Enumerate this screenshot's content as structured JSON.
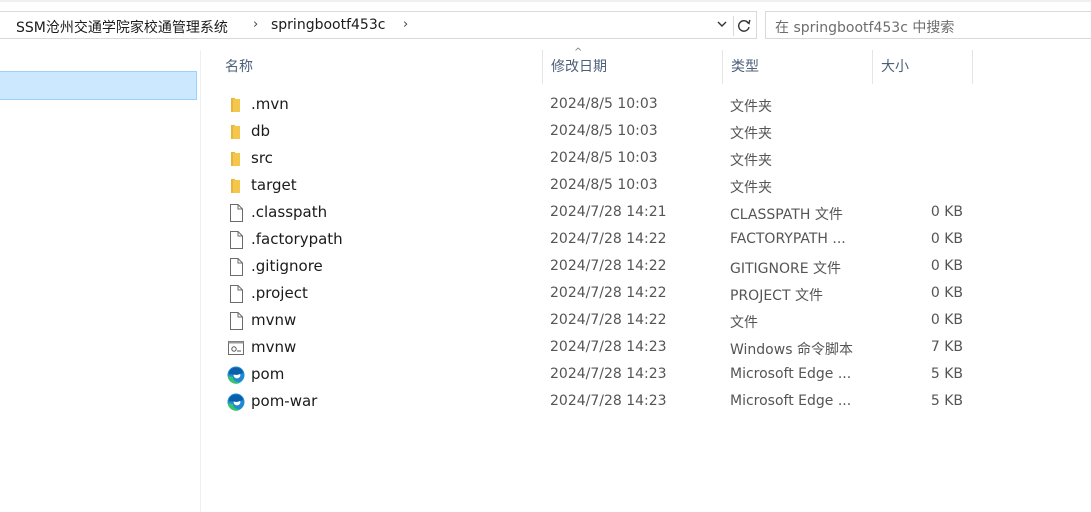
{
  "address_bar": {
    "crumbs": [
      "SSM沧州交通学院家校通管理系统",
      "springbootf453c"
    ]
  },
  "search": {
    "placeholder": "在 springbootf453c 中搜索"
  },
  "columns": {
    "name": "名称",
    "date": "修改日期",
    "type": "类型",
    "size": "大小"
  },
  "files": [
    {
      "name": ".mvn",
      "date": "2024/8/5 10:03",
      "type": "文件夹",
      "size": "",
      "icon": "folder-icon"
    },
    {
      "name": "db",
      "date": "2024/8/5 10:03",
      "type": "文件夹",
      "size": "",
      "icon": "folder-icon"
    },
    {
      "name": "src",
      "date": "2024/8/5 10:03",
      "type": "文件夹",
      "size": "",
      "icon": "folder-icon"
    },
    {
      "name": "target",
      "date": "2024/8/5 10:03",
      "type": "文件夹",
      "size": "",
      "icon": "folder-icon"
    },
    {
      "name": ".classpath",
      "date": "2024/7/28 14:21",
      "type": "CLASSPATH 文件",
      "size": "0 KB",
      "icon": "file-icon"
    },
    {
      "name": ".factorypath",
      "date": "2024/7/28 14:22",
      "type": "FACTORYPATH ...",
      "size": "0 KB",
      "icon": "file-icon"
    },
    {
      "name": ".gitignore",
      "date": "2024/7/28 14:22",
      "type": "GITIGNORE 文件",
      "size": "0 KB",
      "icon": "file-icon"
    },
    {
      "name": ".project",
      "date": "2024/7/28 14:22",
      "type": "PROJECT 文件",
      "size": "0 KB",
      "icon": "file-icon"
    },
    {
      "name": "mvnw",
      "date": "2024/7/28 14:22",
      "type": "文件",
      "size": "0 KB",
      "icon": "file-icon"
    },
    {
      "name": "mvnw",
      "date": "2024/7/28 14:23",
      "type": "Windows 命令脚本",
      "size": "7 KB",
      "icon": "script-icon"
    },
    {
      "name": "pom",
      "date": "2024/7/28 14:23",
      "type": "Microsoft Edge ...",
      "size": "5 KB",
      "icon": "edge-icon"
    },
    {
      "name": "pom-war",
      "date": "2024/7/28 14:23",
      "type": "Microsoft Edge ...",
      "size": "5 KB",
      "icon": "edge-icon"
    }
  ],
  "colors": {
    "selection": "#cce8ff",
    "selection_border": "#99d1ff",
    "header_text": "#4c607a",
    "folder": "#f4c64b"
  }
}
